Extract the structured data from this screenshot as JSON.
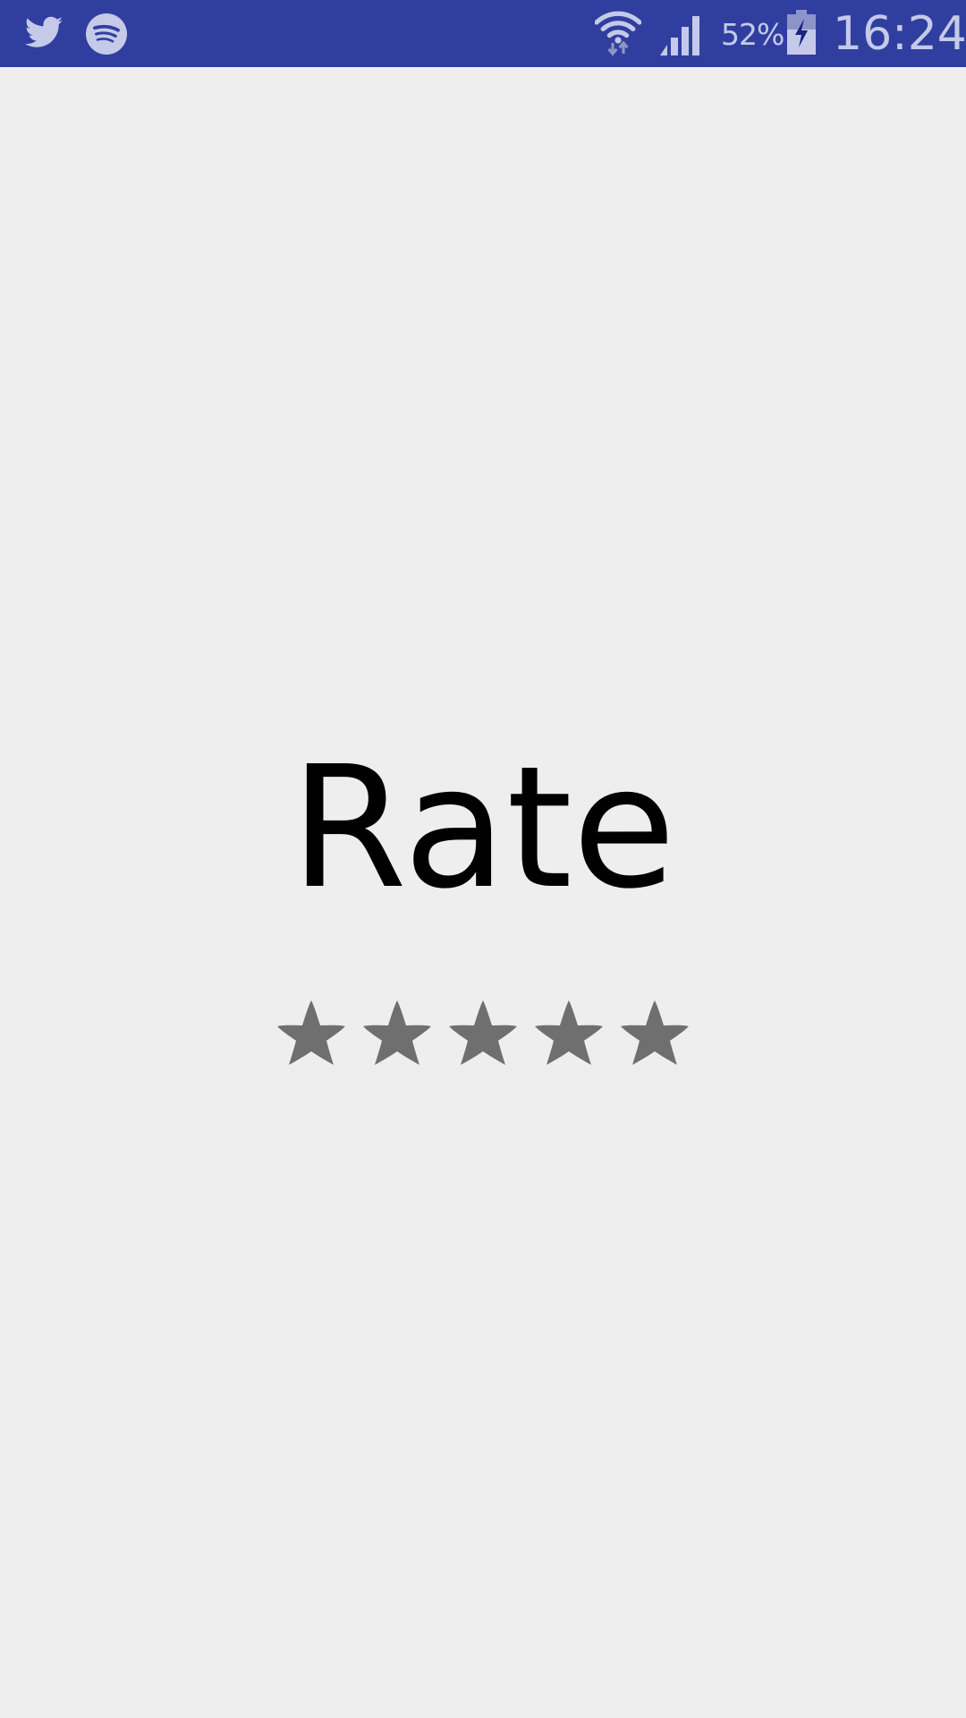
{
  "status_bar": {
    "notification_icons": [
      "twitter-icon",
      "spotify-icon"
    ],
    "wifi_icon": "wifi-icon",
    "signal_icon": "cell-signal-icon",
    "battery_percent": "52%",
    "battery_icon": "battery-charging-icon",
    "battery_level": 0.52,
    "time": "16:24",
    "background_color": "#303f9f",
    "icon_color": "#c5cae9"
  },
  "main": {
    "title": "Rate",
    "rating": {
      "max": 5,
      "value": 0,
      "star_icon": "star-icon",
      "star_color": "#6f6f6f"
    }
  }
}
